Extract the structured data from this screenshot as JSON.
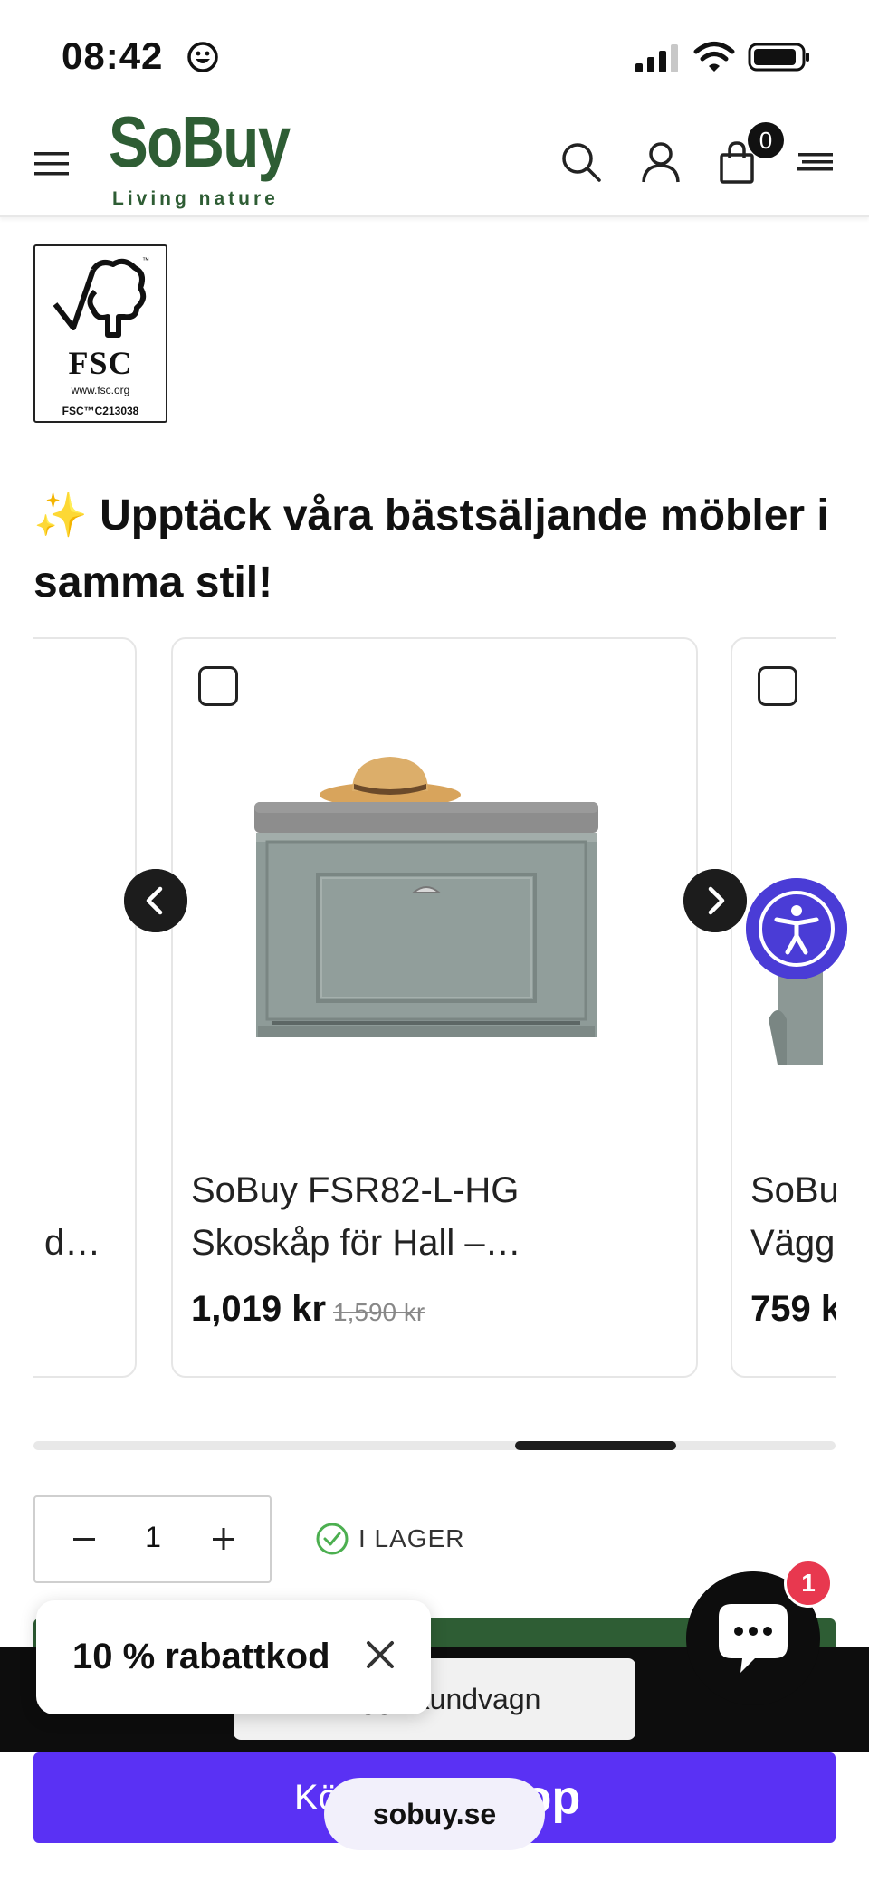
{
  "status_bar": {
    "time": "08:42"
  },
  "header": {
    "brand_name": "SoBuy",
    "brand_tagline": "Living nature",
    "cart_count": "0"
  },
  "fsc": {
    "name": "FSC",
    "url": "www.fsc.org",
    "code": "FSC™C213038"
  },
  "section": {
    "title": "✨ Upptäck våra bästsäljande möbler i samma stil!"
  },
  "carousel": {
    "items": [
      {
        "title_line1": "",
        "title_line2": "d…",
        "price": "",
        "old_price": ""
      },
      {
        "title_line1": "SoBuy FSR82-L-HG",
        "title_line2": "Skoskåp för Hall –…",
        "price": "1,019 kr",
        "old_price": "1,590 kr"
      },
      {
        "title_line1": "SoBu",
        "title_line2": "Vägg",
        "price": "759 k",
        "old_price": ""
      }
    ]
  },
  "quantity": {
    "value": "1"
  },
  "stock": {
    "label": "I LAGER"
  },
  "buttons": {
    "add_to_cart": "Lägg i kundvagn",
    "buy_prefix": "Köp med",
    "buy_shop": "shop"
  },
  "discount_popup": {
    "label": "10 % rabattkod"
  },
  "chat": {
    "badge": "1"
  },
  "browser": {
    "url": "sobuy.se"
  },
  "colors": {
    "brand_green": "#2e5d34",
    "shop_purple": "#5a31f4",
    "accessibility": "#4a3cd6",
    "badge_red": "#e8384f"
  }
}
